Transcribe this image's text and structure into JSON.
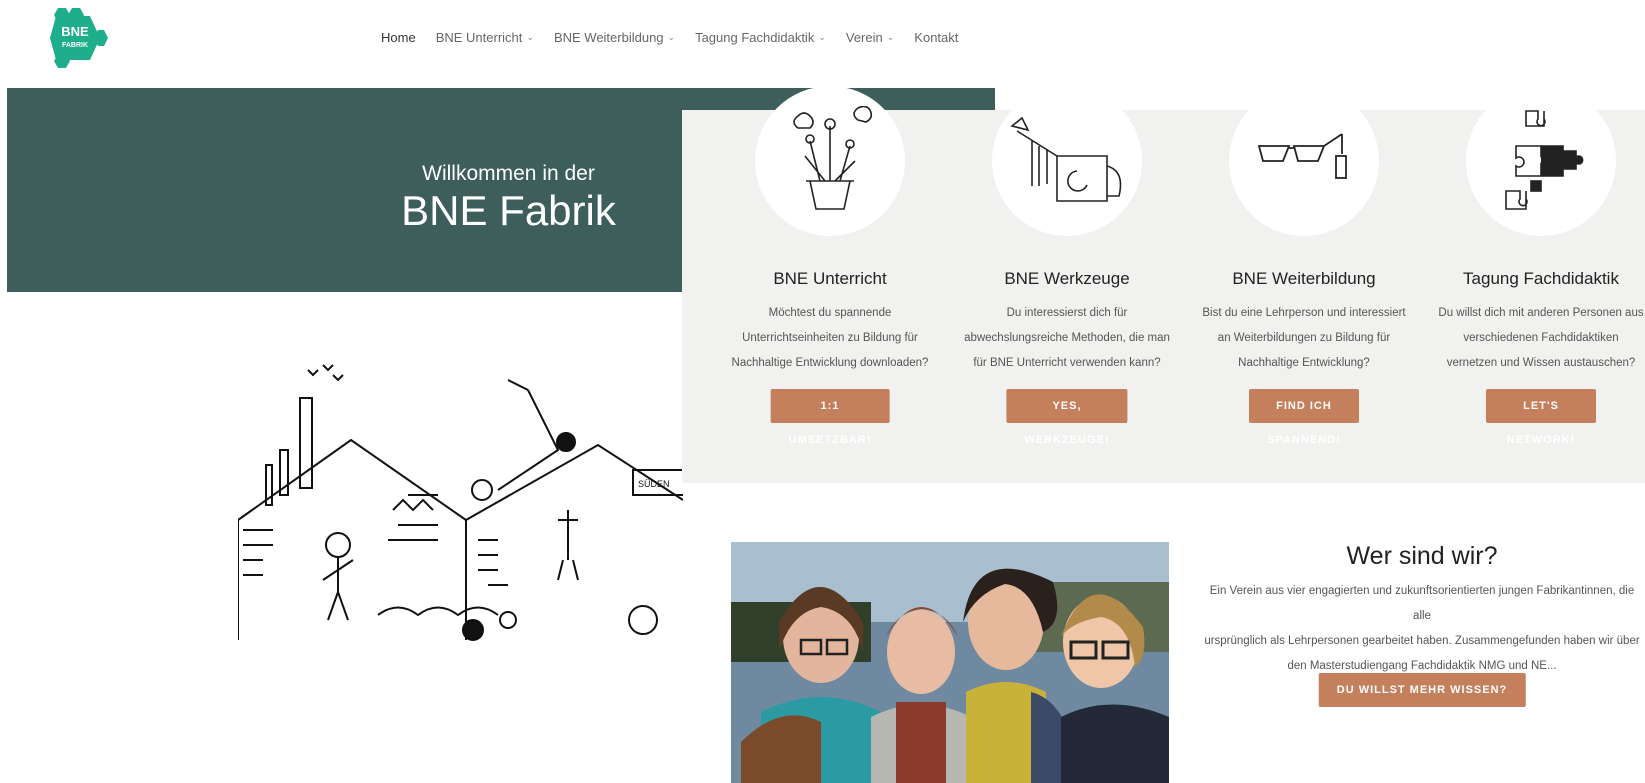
{
  "logo": {
    "line1": "BNE",
    "line2": "FABRIK",
    "color": "#1fae8b"
  },
  "nav": [
    {
      "label": "Home",
      "dropdown": false,
      "active": true
    },
    {
      "label": "BNE Unterricht",
      "dropdown": true
    },
    {
      "label": "BNE Weiterbildung",
      "dropdown": true
    },
    {
      "label": "Tagung Fachdidaktik",
      "dropdown": true
    },
    {
      "label": "Verein",
      "dropdown": true
    },
    {
      "label": "Kontakt",
      "dropdown": false
    }
  ],
  "hero": {
    "subtitle": "Willkommen in der",
    "title": "BNE Fabrik",
    "bg": "#3d5e5a"
  },
  "sketch_sign": "SÜDEN",
  "cards": [
    {
      "icon": "plant-pot-icon",
      "title": "BNE Unterricht",
      "lines": [
        "Möchtest du spannende",
        "Unterrichtseinheiten zu Bildung für",
        "Nachhaltige Entwicklung downloaden?"
      ],
      "button": "1:1 UMSETZBAR!"
    },
    {
      "icon": "watering-can-icon",
      "title": "BNE Werkzeuge",
      "lines": [
        "Du interessierst dich für",
        "abwechslungsreiche Methoden, die man",
        "für BNE Unterricht verwenden kann?"
      ],
      "button": "YES, WERKZEUGE!"
    },
    {
      "icon": "glasses-icon",
      "title": "BNE Weiterbildung",
      "lines": [
        "Bist du eine Lehrperson und interessiert",
        "an Weiterbildungen zu Bildung für",
        "Nachhaltige Entwicklung?"
      ],
      "button": "FIND ICH SPANNEND!"
    },
    {
      "icon": "puzzle-icon",
      "title": "Tagung Fachdidaktik",
      "lines": [
        "Du willst dich mit anderen Personen aus",
        "verschiedenen Fachdidaktiken",
        "vernetzen und Wissen austauschen?"
      ],
      "button": "LET'S NETWORK!"
    }
  ],
  "about": {
    "title": "Wer sind wir?",
    "lines": [
      "Ein Verein aus vier engagierten und zukunftsorientierten jungen Fabrikantinnen, die alle",
      "ursprünglich als Lehrpersonen gearbeitet haben. Zusammengefunden haben wir über",
      "den Masterstudiengang Fachdidaktik NMG und NE..."
    ],
    "button": "DU WILLST MEHR WISSEN?"
  },
  "colors": {
    "accent": "#c47f5c",
    "panel": "#f1f1ef"
  }
}
